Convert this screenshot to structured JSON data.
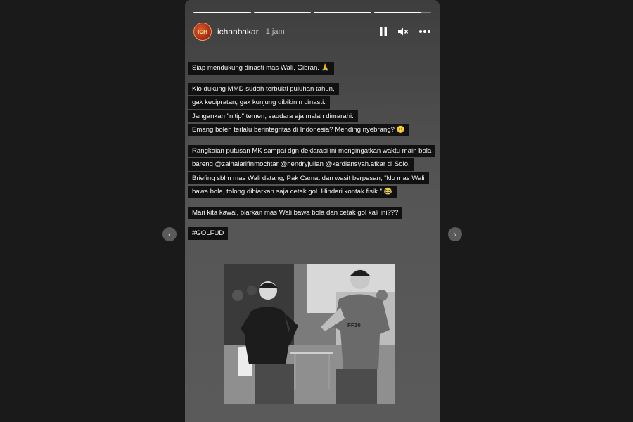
{
  "story": {
    "progress": [
      1,
      1,
      1,
      0.82
    ],
    "user": {
      "avatar_text": "ICH",
      "username": "ichanbakar",
      "time": "1 jam"
    },
    "icons": {
      "pause": "pause-icon",
      "mute": "speaker-muted-icon",
      "more": "more-horizontal-icon"
    },
    "text_blocks": [
      {
        "lines": [
          "Siap mendukung dinasti mas Wali, Gibran. 🙏"
        ]
      },
      {
        "lines": [
          "Klo dukung MMD sudah terbukti puluhan tahun,",
          "gak kecipratan, gak kunjung dibikinin dinasti.",
          "Jangankan \"nitip\" temen, saudara aja malah dimarahi.",
          "Emang boleh terlalu berintegritas di Indonesia? Mending nyebrang? 🤫"
        ]
      },
      {
        "lines": [
          "Rangkaian putusan MK sampai dgn deklarasi ini mengingatkan waktu main bola",
          "bareng @zainalarifinmochtar @hendryjulian @kardiansyah.afkar di Solo.",
          "Briefing sblm mas Wali datang,  Pak Camat dan wasit berpesan, \"klo mas Wali",
          "bawa bola, tolong dibiarkan saja cetak gol. Hindari kontak fisik.\" 😂"
        ]
      },
      {
        "lines": [
          "Mari kita kawal, biarkan mas Wali bawa bola dan cetak gol kali ini???"
        ]
      },
      {
        "lines": [
          "#GOLFUD"
        ]
      }
    ],
    "photo_text": {
      "shirt": "FF30"
    },
    "nav": {
      "prev": "‹",
      "next": "›"
    }
  }
}
